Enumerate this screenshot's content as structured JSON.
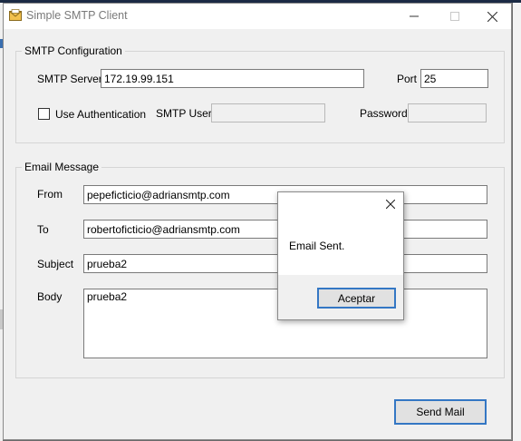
{
  "window": {
    "title": "Simple SMTP Client"
  },
  "smtp_config": {
    "group_label": "SMTP Configuration",
    "server_label": "SMTP Server",
    "server_value": "172.19.99.151",
    "port_label": "Port",
    "port_value": "25",
    "auth_label": "Use Authentication",
    "auth_checked": false,
    "user_label": "SMTP User",
    "user_value": "",
    "password_label": "Password",
    "password_value": ""
  },
  "email_message": {
    "group_label": "Email Message",
    "from_label": "From",
    "from_value": "pepeficticio@adriansmtp.com",
    "to_label": "To",
    "to_value": "robertoficticio@adriansmtp.com",
    "subject_label": "Subject",
    "subject_value": "prueba2",
    "body_label": "Body",
    "body_value": "prueba2"
  },
  "send_button_label": "Send Mail",
  "dialog": {
    "message": "Email Sent.",
    "ok_label": "Aceptar"
  }
}
